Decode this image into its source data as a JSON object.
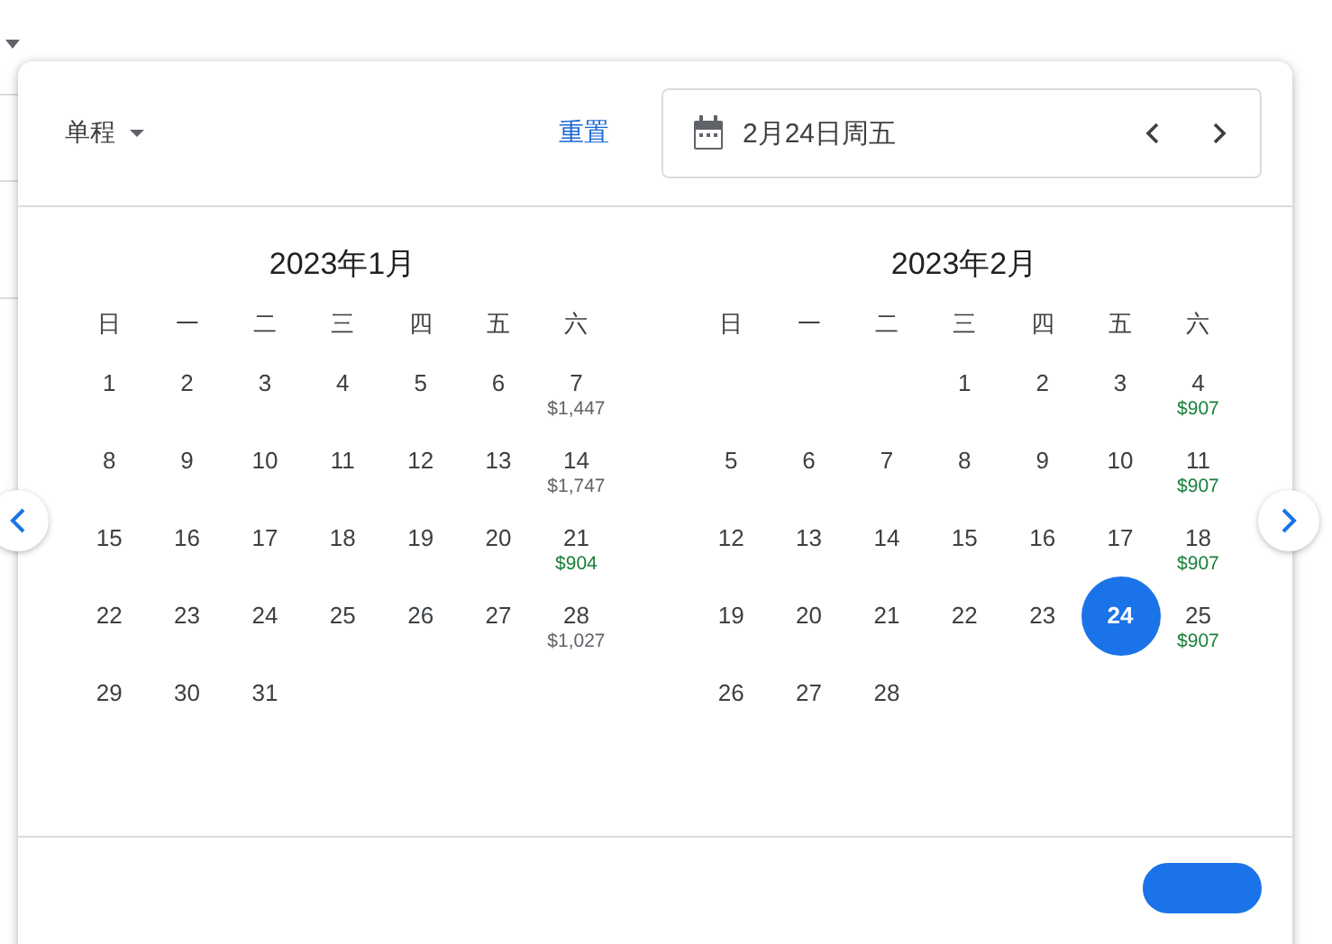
{
  "header": {
    "trip_type": "单程",
    "reset": "重置",
    "date_field": {
      "value": "2月24日周五"
    }
  },
  "months": [
    {
      "title": "2023年1月",
      "weekdays": [
        "日",
        "一",
        "二",
        "三",
        "四",
        "五",
        "六"
      ],
      "weeks": [
        [
          {
            "kind": "day",
            "day": "1",
            "selected": false
          },
          {
            "kind": "day",
            "day": "2",
            "selected": false
          },
          {
            "kind": "day",
            "day": "3",
            "selected": false
          },
          {
            "kind": "day",
            "day": "4",
            "selected": false
          },
          {
            "kind": "day",
            "day": "5",
            "selected": false
          },
          {
            "kind": "day",
            "day": "6",
            "selected": false
          },
          {
            "kind": "day",
            "day": "7",
            "selected": false,
            "price": "$1,447",
            "color": "#5f6368"
          }
        ],
        [
          {
            "kind": "day",
            "day": "8",
            "selected": false
          },
          {
            "kind": "day",
            "day": "9",
            "selected": false
          },
          {
            "kind": "day",
            "day": "10",
            "selected": false
          },
          {
            "kind": "day",
            "day": "11",
            "selected": false
          },
          {
            "kind": "day",
            "day": "12",
            "selected": false
          },
          {
            "kind": "day",
            "day": "13",
            "selected": false
          },
          {
            "kind": "day",
            "day": "14",
            "selected": false,
            "price": "$1,747",
            "color": "#5f6368"
          }
        ],
        [
          {
            "kind": "day",
            "day": "15",
            "selected": false
          },
          {
            "kind": "day",
            "day": "16",
            "selected": false
          },
          {
            "kind": "day",
            "day": "17",
            "selected": false
          },
          {
            "kind": "day",
            "day": "18",
            "selected": false
          },
          {
            "kind": "day",
            "day": "19",
            "selected": false
          },
          {
            "kind": "day",
            "day": "20",
            "selected": false
          },
          {
            "kind": "day",
            "day": "21",
            "selected": false,
            "price": "$904",
            "color": "#188038"
          }
        ],
        [
          {
            "kind": "day",
            "day": "22",
            "selected": false
          },
          {
            "kind": "day",
            "day": "23",
            "selected": false
          },
          {
            "kind": "day",
            "day": "24",
            "selected": false
          },
          {
            "kind": "day",
            "day": "25",
            "selected": false
          },
          {
            "kind": "day",
            "day": "26",
            "selected": false
          },
          {
            "kind": "day",
            "day": "27",
            "selected": false
          },
          {
            "kind": "day",
            "day": "28",
            "selected": false,
            "price": "$1,027",
            "color": "#5f6368"
          }
        ],
        [
          {
            "kind": "day",
            "day": "29",
            "selected": false
          },
          {
            "kind": "day",
            "day": "30",
            "selected": false
          },
          {
            "kind": "day",
            "day": "31",
            "selected": false
          },
          {
            "kind": "blank"
          },
          {
            "kind": "blank"
          },
          {
            "kind": "blank"
          },
          {
            "kind": "blank"
          }
        ]
      ]
    },
    {
      "title": "2023年2月",
      "weekdays": [
        "日",
        "一",
        "二",
        "三",
        "四",
        "五",
        "六"
      ],
      "weeks": [
        [
          {
            "kind": "blank"
          },
          {
            "kind": "blank"
          },
          {
            "kind": "blank"
          },
          {
            "kind": "day",
            "day": "1",
            "selected": false
          },
          {
            "kind": "day",
            "day": "2",
            "selected": false
          },
          {
            "kind": "day",
            "day": "3",
            "selected": false
          },
          {
            "kind": "day",
            "day": "4",
            "selected": false,
            "price": "$907",
            "color": "#188038"
          }
        ],
        [
          {
            "kind": "day",
            "day": "5",
            "selected": false
          },
          {
            "kind": "day",
            "day": "6",
            "selected": false
          },
          {
            "kind": "day",
            "day": "7",
            "selected": false
          },
          {
            "kind": "day",
            "day": "8",
            "selected": false
          },
          {
            "kind": "day",
            "day": "9",
            "selected": false
          },
          {
            "kind": "day",
            "day": "10",
            "selected": false
          },
          {
            "kind": "day",
            "day": "11",
            "selected": false,
            "price": "$907",
            "color": "#188038"
          }
        ],
        [
          {
            "kind": "day",
            "day": "12",
            "selected": false
          },
          {
            "kind": "day",
            "day": "13",
            "selected": false
          },
          {
            "kind": "day",
            "day": "14",
            "selected": false
          },
          {
            "kind": "day",
            "day": "15",
            "selected": false
          },
          {
            "kind": "day",
            "day": "16",
            "selected": false
          },
          {
            "kind": "day",
            "day": "17",
            "selected": false
          },
          {
            "kind": "day",
            "day": "18",
            "selected": false,
            "price": "$907",
            "color": "#188038"
          }
        ],
        [
          {
            "kind": "day",
            "day": "19",
            "selected": false
          },
          {
            "kind": "day",
            "day": "20",
            "selected": false
          },
          {
            "kind": "day",
            "day": "21",
            "selected": false
          },
          {
            "kind": "day",
            "day": "22",
            "selected": false
          },
          {
            "kind": "day",
            "day": "23",
            "selected": false
          },
          {
            "kind": "day",
            "day": "24",
            "selected": true
          },
          {
            "kind": "day",
            "day": "25",
            "selected": false,
            "price": "$907",
            "color": "#188038"
          }
        ],
        [
          {
            "kind": "day",
            "day": "26",
            "selected": false
          },
          {
            "kind": "day",
            "day": "27",
            "selected": false
          },
          {
            "kind": "day",
            "day": "28",
            "selected": false
          },
          {
            "kind": "blank"
          },
          {
            "kind": "blank"
          },
          {
            "kind": "blank"
          },
          {
            "kind": "blank"
          }
        ]
      ]
    }
  ],
  "footer": {
    "button": {
      "kind": "primary"
    }
  }
}
